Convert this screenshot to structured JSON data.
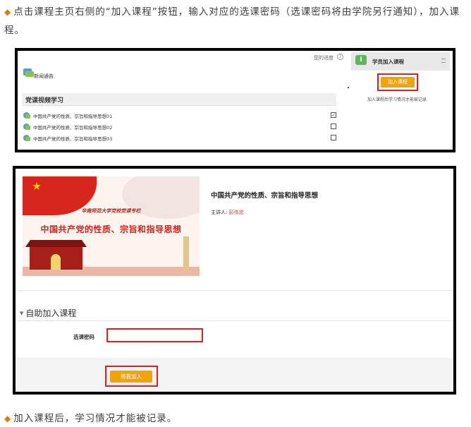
{
  "instructions": {
    "step1": "点击课程主页右侧的“加入课程”按钮，输入对应的选课密码（选课密码将由学院另行通知），加入课程。",
    "step2": "加入课程后，学习情况才能被记录。"
  },
  "shot1": {
    "progress_label": "您的进度",
    "help_icon": "?",
    "news_label": "新闻通告",
    "section_title": "党课视频学习",
    "lessons": [
      {
        "title": "中国共产党的性质、宗旨和指导思想01",
        "checked": true
      },
      {
        "title": "中国共产党的性质、宗旨和指导思想02",
        "checked": false
      },
      {
        "title": "中国共产党的性质、宗旨和指导思想03",
        "checked": false
      }
    ],
    "enroll_block": {
      "title": "学员加入课程",
      "info_icon": "i",
      "button": "加入课程",
      "note": "加入课程后学习情况才能被记录"
    },
    "highlight_color": "#e02020",
    "button_color": "#f0a30a"
  },
  "shot2": {
    "banner_school": "华南师范大学党校党课专栏",
    "banner_title": "中国共产党的性质、宗旨和指导思想",
    "course_title": "中国共产党的性质、宗旨和指导思想",
    "lecturer_label": "主讲人: ",
    "lecturer_name": "彭伟忠",
    "self_enroll_title": "自助加入课程",
    "password_label": "选课密码",
    "password_value": "",
    "join_button": "将我加入"
  }
}
